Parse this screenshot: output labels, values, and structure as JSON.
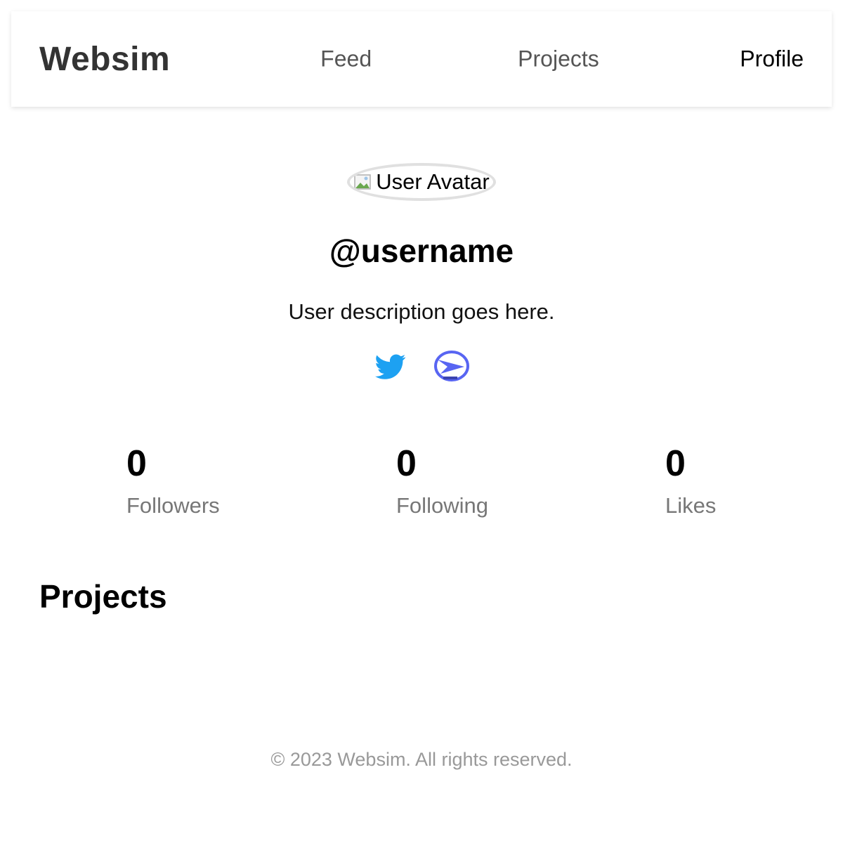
{
  "header": {
    "logo": "Websim",
    "nav": [
      {
        "label": "Feed"
      },
      {
        "label": "Projects"
      },
      {
        "label": "Profile"
      }
    ]
  },
  "profile": {
    "avatar_alt": "User Avatar",
    "username": "@username",
    "description": "User description goes here.",
    "socials": [
      {
        "icon": "twitter-icon",
        "color": "#1DA1F2"
      },
      {
        "icon": "discord-icon",
        "color": "#5865F2"
      }
    ]
  },
  "stats": [
    {
      "value": "0",
      "label": "Followers"
    },
    {
      "value": "0",
      "label": "Following"
    },
    {
      "value": "0",
      "label": "Likes"
    }
  ],
  "projects": {
    "title": "Projects"
  },
  "footer": {
    "text": "© 2023 Websim. All rights reserved."
  },
  "colors": {
    "logo": "#333333",
    "nav_inactive": "#555555",
    "nav_active": "#000000",
    "muted": "#777777",
    "footer": "#999999"
  }
}
